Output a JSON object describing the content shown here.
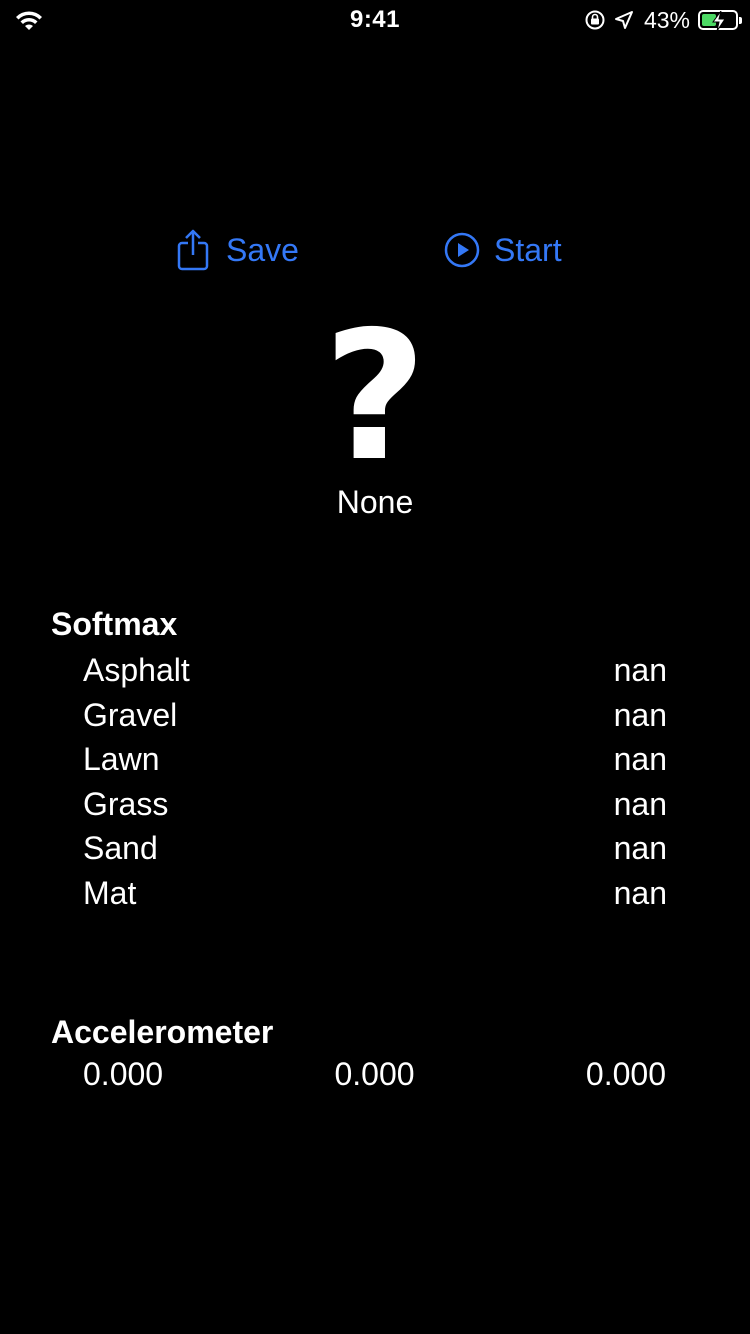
{
  "status_bar": {
    "time": "9:41",
    "battery_percent": "43%",
    "battery_level": 0.43,
    "icons": [
      "wifi-icon",
      "orientation-lock-icon",
      "location-arrow-icon",
      "battery-charging-icon"
    ]
  },
  "toolbar": {
    "save_label": "Save",
    "save_icon": "share-icon",
    "start_label": "Start",
    "start_icon": "play-circle-icon",
    "accent_color": "#3478f6"
  },
  "prediction": {
    "symbol": "?",
    "label": "None"
  },
  "softmax": {
    "title": "Softmax",
    "rows": [
      {
        "label": "Asphalt",
        "value": "nan"
      },
      {
        "label": "Gravel",
        "value": "nan"
      },
      {
        "label": "Lawn",
        "value": "nan"
      },
      {
        "label": "Grass",
        "value": "nan"
      },
      {
        "label": "Sand",
        "value": "nan"
      },
      {
        "label": "Mat",
        "value": "nan"
      }
    ]
  },
  "accelerometer": {
    "title": "Accelerometer",
    "values": [
      "0.000",
      "0.000",
      "0.000"
    ]
  }
}
